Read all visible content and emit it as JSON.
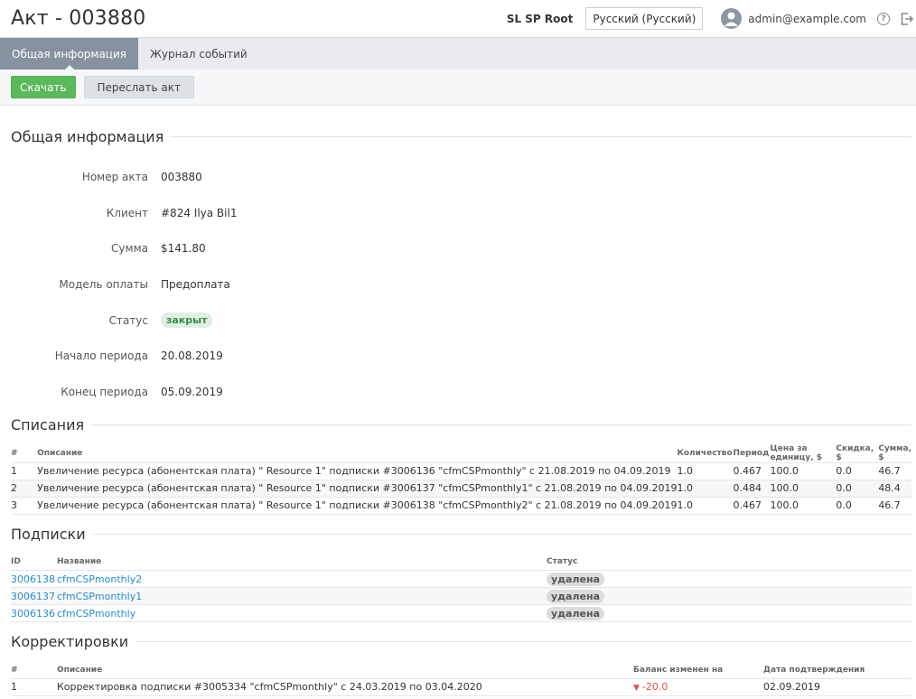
{
  "header": {
    "title": "Акт - 003880",
    "account": "SL SP Root",
    "language": "Русский (Русский)",
    "user_email": "admin@example.com",
    "help": "?"
  },
  "tabs": [
    {
      "label": "Общая информация",
      "active": true
    },
    {
      "label": "Журнал событий",
      "active": false
    }
  ],
  "toolbar": {
    "download_label": "Скачать",
    "resend_label": "Переслать акт"
  },
  "general": {
    "title": "Общая информация",
    "fields": [
      {
        "label": "Номер акта",
        "value": "003880"
      },
      {
        "label": "Клиент",
        "value": "#824 Ilya Bil1"
      },
      {
        "label": "Сумма",
        "value": "$141.80"
      },
      {
        "label": "Модель оплаты",
        "value": "Предоплата"
      },
      {
        "label": "Статус",
        "value": "закрыт"
      },
      {
        "label": "Начало периода",
        "value": "20.08.2019"
      },
      {
        "label": "Конец периода",
        "value": "05.09.2019"
      }
    ]
  },
  "charges": {
    "title": "Списания",
    "columns": [
      "#",
      "Описание",
      "Количество",
      "Период",
      "Цена за единицу, $",
      "Скидка, $",
      "Сумма, $"
    ],
    "rows": [
      {
        "num": "1",
        "desc": "Увеличение ресурса (абонентская плата) \" Resource 1\" подписки #3006136 \"cfmCSPmonthly\" с 21.08.2019 по 04.09.2019",
        "qty": "1.0",
        "period": "0.467",
        "price": "100.0",
        "discount": "0.0",
        "sum": "46.7"
      },
      {
        "num": "2",
        "desc": "Увеличение ресурса (абонентская плата) \" Resource 1\" подписки #3006137 \"cfmCSPmonthly1\" с 21.08.2019 по 04.09.2019",
        "qty": "1.0",
        "period": "0.484",
        "price": "100.0",
        "discount": "0.0",
        "sum": "48.4"
      },
      {
        "num": "3",
        "desc": "Увеличение ресурса (абонентская плата) \" Resource 1\" подписки #3006138 \"cfmCSPmonthly2\" с 21.08.2019 по 04.09.2019",
        "qty": "1.0",
        "period": "0.467",
        "price": "100.0",
        "discount": "0.0",
        "sum": "46.7"
      }
    ]
  },
  "subscriptions": {
    "title": "Подписки",
    "columns": [
      "ID",
      "Название",
      "Статус"
    ],
    "rows": [
      {
        "id": "3006138",
        "name": "cfmCSPmonthly2",
        "status": "удалена"
      },
      {
        "id": "3006137",
        "name": "cfmCSPmonthly1",
        "status": "удалена"
      },
      {
        "id": "3006136",
        "name": "cfmCSPmonthly",
        "status": "удалена"
      }
    ]
  },
  "adjustments": {
    "title": "Корректировки",
    "columns": [
      "#",
      "Описание",
      "Баланс изменен на",
      "Дата подтверждения"
    ],
    "rows": [
      {
        "num": "1",
        "desc": "Корректировка подписки #3005334 \"cfmCSPmonthly\" с 24.03.2019 по 03.04.2020",
        "change": "-20.0",
        "date": "02.09.2019"
      }
    ]
  }
}
